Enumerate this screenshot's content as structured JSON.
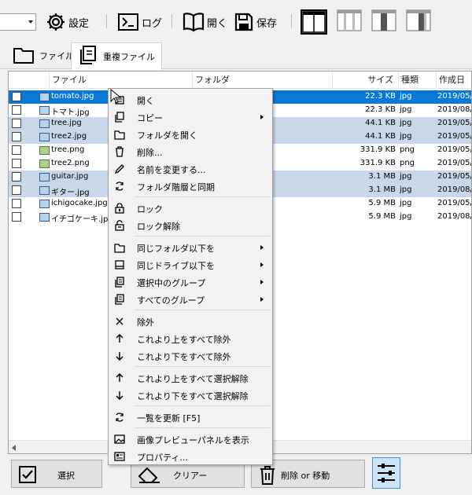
{
  "toolbar": {
    "settings_label": "設定",
    "log_label": "ログ",
    "open_label": "開く",
    "save_label": "保存"
  },
  "tabs": [
    {
      "label": "ファイル",
      "icon": "folder-icon",
      "active": false
    },
    {
      "label": "重複ファイル",
      "icon": "copy-icon",
      "active": true
    }
  ],
  "columns": {
    "file": "ファイル",
    "folder": "フォルダ",
    "size": "サイズ",
    "type": "種類",
    "date": "作成日"
  },
  "rows": [
    {
      "name": "tomato.jpg",
      "size": "22.3 KB",
      "type": "jpg",
      "date": "2019/05/",
      "state": "selected"
    },
    {
      "name": "トマト.jpg",
      "size": "22.3 KB",
      "type": "jpg",
      "date": "2019/08/",
      "state": "normal"
    },
    {
      "name": "tree.jpg",
      "size": "44.1 KB",
      "type": "jpg",
      "date": "2019/05/",
      "state": "group"
    },
    {
      "name": "tree2.jpg",
      "size": "44.1 KB",
      "type": "jpg",
      "date": "2019/05/",
      "state": "group"
    },
    {
      "name": "tree.png",
      "size": "331.9 KB",
      "type": "png",
      "date": "2019/05/",
      "state": "normal"
    },
    {
      "name": "tree2.png",
      "size": "331.9 KB",
      "type": "png",
      "date": "2019/05/",
      "state": "normal"
    },
    {
      "name": "guitar.jpg",
      "size": "3.1 MB",
      "type": "jpg",
      "date": "2019/05/",
      "state": "group"
    },
    {
      "name": "ギター.jpg",
      "size": "3.1 MB",
      "type": "jpg",
      "date": "2019/08/",
      "state": "group"
    },
    {
      "name": "ichigocake.jpg",
      "size": "5.9 MB",
      "type": "jpg",
      "date": "2019/05/",
      "state": "normal"
    },
    {
      "name": "イチゴケーキ.jpg",
      "size": "5.9 MB",
      "type": "jpg",
      "date": "2019/08/",
      "state": "normal"
    }
  ],
  "menu": {
    "open": "開く",
    "copy": "コピー",
    "open_folder": "フォルダを開く",
    "delete": "削除...",
    "rename": "名前を変更する...",
    "sync": "フォルダ階層と同期",
    "lock": "ロック",
    "unlock": "ロック解除",
    "same_folder": "同じフォルダ以下を",
    "same_drive": "同じドライブ以下を",
    "selected_group": "選択中のグループ",
    "all_groups": "すべてのグループ",
    "exclude": "除外",
    "exclude_above": "これより上をすべて除外",
    "exclude_below": "これより下をすべて除外",
    "deselect_above": "これより上をすべて選択解除",
    "deselect_below": "これより下をすべて選択解除",
    "refresh": "一覧を更新 [F5]",
    "preview": "画像プレビューパネルを表示",
    "properties": "プロパティ..."
  },
  "bottom": {
    "select_label": "選択",
    "clear_label": "クリアー",
    "delete_move_label": "削除 or 移動"
  },
  "colors": {
    "selection": "#0a78d7",
    "group_row": "#c8d8e8",
    "filter_active": "#cce4f7"
  }
}
